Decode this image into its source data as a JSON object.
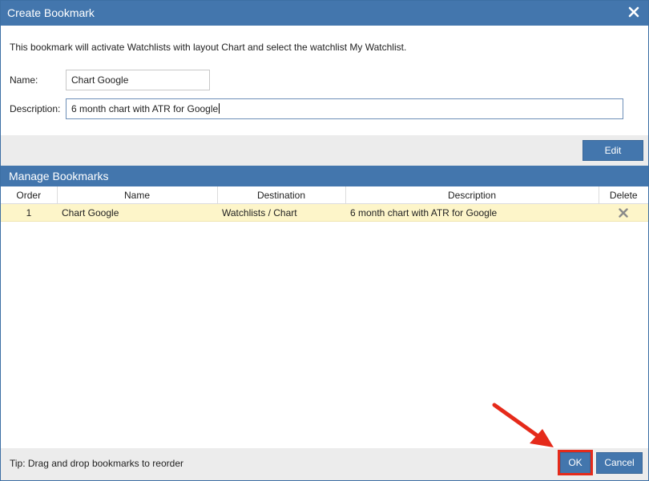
{
  "dialog": {
    "title": "Create Bookmark",
    "close_icon": "close-icon"
  },
  "form": {
    "info_text": "This bookmark will activate Watchlists with layout Chart and select the watchlist My Watchlist.",
    "name_label": "Name:",
    "name_value": "Chart Google",
    "description_label": "Description:",
    "description_value": "6 month chart with ATR for Google"
  },
  "edit_button_label": "Edit",
  "manage": {
    "title": "Manage Bookmarks",
    "columns": [
      "Order",
      "Name",
      "Destination",
      "Description",
      "Delete"
    ],
    "rows": [
      {
        "order": "1",
        "name": "Chart Google",
        "destination": "Watchlists / Chart",
        "description": "6 month chart with ATR for Google",
        "delete_icon": "delete-x-icon"
      }
    ]
  },
  "footer": {
    "tip": "Tip: Drag and drop bookmarks to reorder",
    "ok_label": "OK",
    "cancel_label": "Cancel"
  },
  "colors": {
    "header_blue": "#4376ad",
    "highlight_red": "#e52a1a",
    "selected_row": "#fdf5c9"
  }
}
